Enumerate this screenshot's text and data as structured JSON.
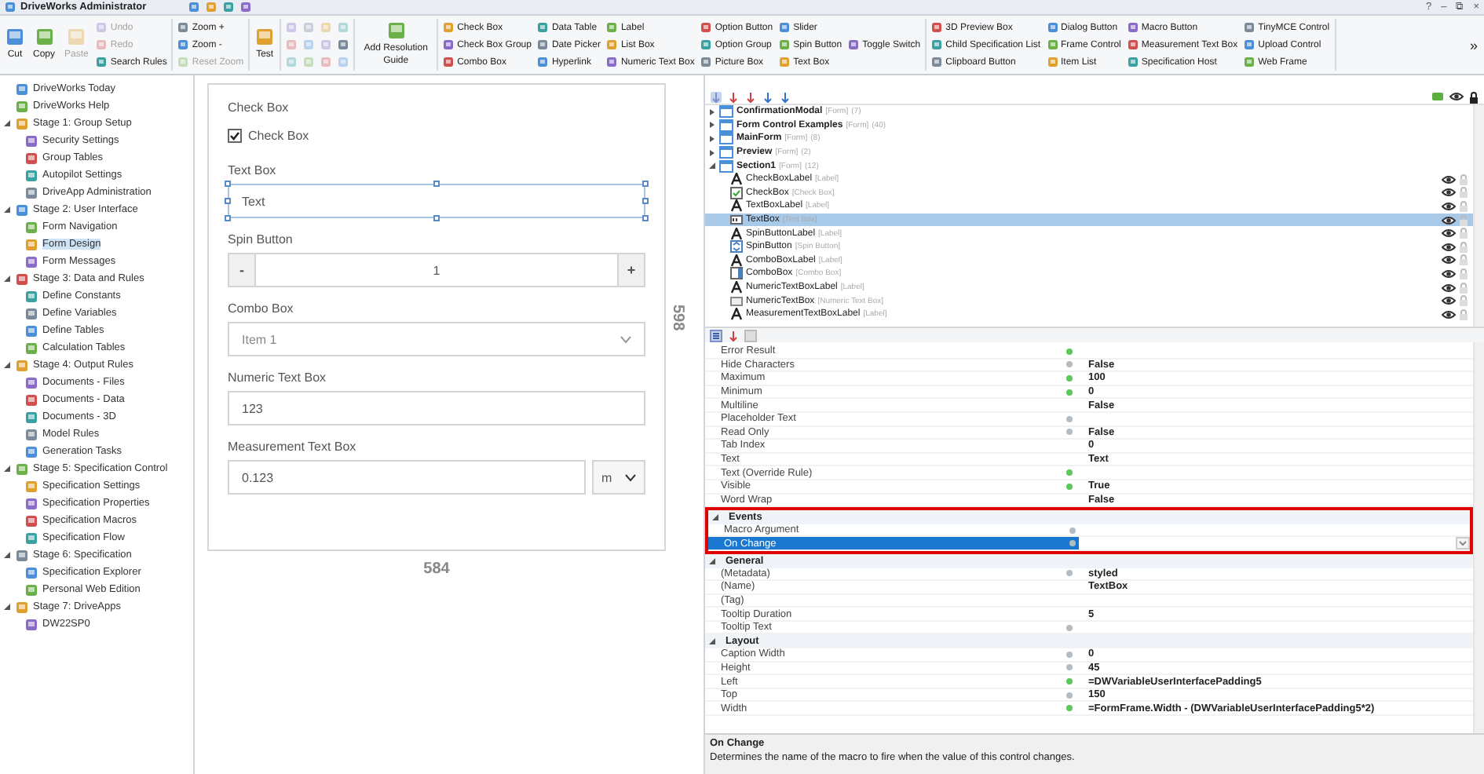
{
  "window": {
    "title": "DriveWorks Administrator",
    "controls": [
      "?",
      "–",
      "⧉",
      "×"
    ]
  },
  "ribbon": {
    "groups": [
      {
        "columns": [
          {
            "kind": "large",
            "label": "Cut",
            "disabled": false
          },
          {
            "kind": "large",
            "label": "Copy",
            "disabled": false
          },
          {
            "kind": "large",
            "label": "Paste",
            "disabled": true
          },
          {
            "kind": "stack",
            "items": [
              {
                "label": "Undo",
                "disabled": true
              },
              {
                "label": "Redo",
                "disabled": true
              },
              {
                "label": "Search Rules",
                "disabled": false
              }
            ]
          }
        ]
      },
      {
        "columns": [
          {
            "kind": "stack",
            "items": [
              {
                "label": "Zoom +",
                "disabled": false
              },
              {
                "label": "Zoom -",
                "disabled": false
              },
              {
                "label": "Reset Zoom",
                "disabled": true
              }
            ]
          }
        ]
      },
      {
        "columns": [
          {
            "kind": "large",
            "label": "Test",
            "disabled": false
          }
        ]
      },
      {
        "columns": [
          {
            "kind": "stack",
            "items": [
              {
                "disabled": true
              },
              {
                "disabled": true
              },
              {
                "disabled": true
              }
            ]
          },
          {
            "kind": "stack",
            "items": [
              {
                "disabled": true
              },
              {
                "disabled": true
              },
              {
                "disabled": true
              }
            ]
          },
          {
            "kind": "stack",
            "items": [
              {
                "disabled": true
              },
              {
                "disabled": true
              },
              {
                "disabled": true
              }
            ]
          },
          {
            "kind": "stack",
            "items": [
              {
                "disabled": true
              },
              {
                "disabled": false
              },
              {
                "disabled": true
              }
            ]
          }
        ]
      },
      {
        "columns": [
          {
            "kind": "large",
            "label": "Add Resolution Guide",
            "disabled": false
          }
        ]
      },
      {
        "columns": [
          {
            "kind": "stack",
            "items": [
              {
                "label": "Check Box",
                "disabled": false
              },
              {
                "label": "Check Box Group",
                "disabled": false
              },
              {
                "label": "Combo Box",
                "disabled": false
              }
            ]
          },
          {
            "kind": "stack",
            "items": [
              {
                "label": "Data Table",
                "disabled": false
              },
              {
                "label": "Date Picker",
                "disabled": false
              },
              {
                "label": "Hyperlink",
                "disabled": false
              }
            ]
          },
          {
            "kind": "stack",
            "items": [
              {
                "label": "Label",
                "disabled": false
              },
              {
                "label": "List Box",
                "disabled": false
              },
              {
                "label": "Numeric Text Box",
                "disabled": false
              }
            ]
          },
          {
            "kind": "stack",
            "items": [
              {
                "label": "Option Button",
                "disabled": false
              },
              {
                "label": "Option Group",
                "disabled": false
              },
              {
                "label": "Picture Box",
                "disabled": false
              }
            ]
          },
          {
            "kind": "stack",
            "items": [
              {
                "label": "Slider",
                "disabled": false
              },
              {
                "label": "Spin Button",
                "disabled": false
              },
              {
                "label": "Text Box",
                "disabled": false
              }
            ]
          },
          {
            "kind": "stack",
            "items": [
              {
                "label": "Toggle Switch",
                "disabled": false
              }
            ]
          }
        ]
      },
      {
        "columns": [
          {
            "kind": "stack",
            "items": [
              {
                "label": "3D Preview Box",
                "disabled": false
              },
              {
                "label": "Child Specification List",
                "disabled": false
              },
              {
                "label": "Clipboard Button",
                "disabled": false
              }
            ]
          },
          {
            "kind": "stack",
            "items": [
              {
                "label": "Dialog Button",
                "disabled": false
              },
              {
                "label": "Frame Control",
                "disabled": false
              },
              {
                "label": "Item List",
                "disabled": false
              }
            ]
          },
          {
            "kind": "stack",
            "items": [
              {
                "label": "Macro Button",
                "disabled": false
              },
              {
                "label": "Measurement Text Box",
                "disabled": false
              },
              {
                "label": "Specification Host",
                "disabled": false
              }
            ]
          },
          {
            "kind": "stack",
            "items": [
              {
                "label": "TinyMCE Control",
                "disabled": false
              },
              {
                "label": "Upload Control",
                "disabled": false
              },
              {
                "label": "Web Frame",
                "disabled": false
              }
            ]
          }
        ]
      }
    ],
    "overflow": "»"
  },
  "sidebar": {
    "items": [
      {
        "label": "DriveWorks Today",
        "selected": false
      },
      {
        "label": "DriveWorks Help",
        "selected": false
      },
      {
        "label": "Stage 1: Group Setup",
        "selected": false,
        "expanded": true,
        "children": [
          {
            "label": "Security Settings",
            "selected": false
          },
          {
            "label": "Group Tables",
            "selected": false
          },
          {
            "label": "Autopilot Settings",
            "selected": false
          },
          {
            "label": "DriveApp Administration",
            "selected": false
          }
        ]
      },
      {
        "label": "Stage 2: User Interface",
        "selected": false,
        "expanded": true,
        "children": [
          {
            "label": "Form Navigation",
            "selected": false
          },
          {
            "label": "Form Design",
            "selected": true
          },
          {
            "label": "Form Messages",
            "selected": false
          }
        ]
      },
      {
        "label": "Stage 3: Data and Rules",
        "selected": false,
        "expanded": true,
        "children": [
          {
            "label": "Define Constants",
            "selected": false
          },
          {
            "label": "Define Variables",
            "selected": false
          },
          {
            "label": "Define Tables",
            "selected": false
          },
          {
            "label": "Calculation Tables",
            "selected": false
          }
        ]
      },
      {
        "label": "Stage 4: Output Rules",
        "selected": false,
        "expanded": true,
        "children": [
          {
            "label": "Documents - Files",
            "selected": false
          },
          {
            "label": "Documents - Data",
            "selected": false
          },
          {
            "label": "Documents - 3D",
            "selected": false
          },
          {
            "label": "Model Rules",
            "selected": false
          },
          {
            "label": "Generation Tasks",
            "selected": false
          }
        ]
      },
      {
        "label": "Stage 5: Specification Control",
        "selected": false,
        "expanded": true,
        "children": [
          {
            "label": "Specification Settings",
            "selected": false
          },
          {
            "label": "Specification Properties",
            "selected": false
          },
          {
            "label": "Specification Macros",
            "selected": false
          },
          {
            "label": "Specification Flow",
            "selected": false
          }
        ]
      },
      {
        "label": "Stage 6: Specification",
        "selected": false,
        "expanded": true,
        "children": [
          {
            "label": "Specification Explorer",
            "selected": false
          },
          {
            "label": "Personal Web Edition",
            "selected": false
          }
        ]
      },
      {
        "label": "Stage 7: DriveApps",
        "selected": false,
        "expanded": true,
        "children": [
          {
            "label": "DW22SP0",
            "selected": false
          }
        ]
      }
    ]
  },
  "canvas": {
    "width_label": "584",
    "height_label": "598",
    "controls": [
      {
        "kind": "label",
        "text": "Check Box"
      },
      {
        "kind": "checkbox",
        "text": "Check Box",
        "checked": true,
        "selected": false
      },
      {
        "kind": "label",
        "text": "Text Box"
      },
      {
        "kind": "textbox",
        "value": "Text",
        "selected": true
      },
      {
        "kind": "label",
        "text": "Spin Button"
      },
      {
        "kind": "spin",
        "minus": "-",
        "value": "1",
        "plus": "+",
        "selected": false
      },
      {
        "kind": "label",
        "text": "Combo Box"
      },
      {
        "kind": "combo",
        "value": "Item 1",
        "selected": false
      },
      {
        "kind": "label",
        "text": "Numeric Text Box"
      },
      {
        "kind": "textbox",
        "value": "123",
        "selected": false
      },
      {
        "kind": "label",
        "text": "Measurement Text Box"
      },
      {
        "kind": "measurement",
        "value": "0.123",
        "unit": "m",
        "selected": false
      }
    ]
  },
  "tree": {
    "items": [
      {
        "name": "ConfirmationModal",
        "type": "[Form]",
        "count": "(7)",
        "expanded": false,
        "selected": false
      },
      {
        "name": "Form Control Examples",
        "type": "[Form]",
        "count": "(40)",
        "expanded": false,
        "selected": false
      },
      {
        "name": "MainForm",
        "type": "[Form]",
        "count": "(8)",
        "expanded": false,
        "selected": false
      },
      {
        "name": "Preview",
        "type": "[Form]",
        "count": "(2)",
        "expanded": false,
        "selected": false
      },
      {
        "name": "Section1",
        "type": "[Form]",
        "count": "(12)",
        "expanded": true,
        "selected": false,
        "children": [
          {
            "kind": "label",
            "name": "CheckBoxLabel",
            "type": "[Label]",
            "selected": false
          },
          {
            "kind": "checkbox",
            "name": "CheckBox",
            "type": "[Check Box]",
            "selected": false
          },
          {
            "kind": "label",
            "name": "TextBoxLabel",
            "type": "[Label]",
            "selected": false
          },
          {
            "kind": "textbox",
            "name": "TextBox",
            "type": "[Text Box]",
            "selected": true
          },
          {
            "kind": "label",
            "name": "SpinButtonLabel",
            "type": "[Label]",
            "selected": false
          },
          {
            "kind": "spin",
            "name": "SpinButton",
            "type": "[Spin Button]",
            "selected": false
          },
          {
            "kind": "label",
            "name": "ComboBoxLabel",
            "type": "[Label]",
            "selected": false
          },
          {
            "kind": "combo",
            "name": "ComboBox",
            "type": "[Combo Box]",
            "selected": false
          },
          {
            "kind": "label",
            "name": "NumericTextBoxLabel",
            "type": "[Label]",
            "selected": false
          },
          {
            "kind": "numeric",
            "name": "NumericTextBox",
            "type": "[Numeric Text Box]",
            "selected": false
          },
          {
            "kind": "label",
            "name": "MeasurementTextBoxLabel",
            "type": "[Label]",
            "selected": false
          }
        ]
      }
    ]
  },
  "properties": {
    "rows": [
      {
        "kind": "row",
        "name": "Error Result",
        "color": "#5cc85c",
        "selected": false
      },
      {
        "kind": "row",
        "name": "Hide Characters",
        "color": "#b4bcc4",
        "value": "False",
        "selected": false
      },
      {
        "kind": "row",
        "name": "Maximum",
        "color": "#5cc85c",
        "value": "100",
        "selected": false
      },
      {
        "kind": "row",
        "name": "Minimum",
        "color": "#5cc85c",
        "value": "0",
        "selected": false
      },
      {
        "kind": "row",
        "name": "Multiline",
        "value": "False",
        "selected": false
      },
      {
        "kind": "row",
        "name": "Placeholder Text",
        "color": "#b4bcc4",
        "selected": false
      },
      {
        "kind": "row",
        "name": "Read Only",
        "color": "#b4bcc4",
        "value": "False",
        "selected": false
      },
      {
        "kind": "row",
        "name": "Tab Index",
        "value": "0",
        "selected": false
      },
      {
        "kind": "row",
        "name": "Text",
        "value": "Text",
        "selected": false
      },
      {
        "kind": "row",
        "name": "Text (Override Rule)",
        "color": "#5cc85c",
        "selected": false
      },
      {
        "kind": "row",
        "name": "Visible",
        "color": "#5cc85c",
        "value": "True",
        "selected": false
      },
      {
        "kind": "row",
        "name": "Word Wrap",
        "value": "False",
        "selected": false
      },
      {
        "kind": "category",
        "name": "Events",
        "expanded": true,
        "highlighted": true
      },
      {
        "kind": "row",
        "name": "Macro Argument",
        "color": "#b4bcc4",
        "selected": false,
        "highlighted": true
      },
      {
        "kind": "row",
        "name": "On Change",
        "color": "#b4bcc4",
        "selected": true,
        "dropdown": true,
        "highlighted": true
      },
      {
        "kind": "category",
        "name": "General",
        "expanded": true
      },
      {
        "kind": "row",
        "name": "(Metadata)",
        "color": "#b4bcc4",
        "value": "styled",
        "selected": false
      },
      {
        "kind": "row",
        "name": "(Name)",
        "value": "TextBox",
        "selected": false
      },
      {
        "kind": "row",
        "name": "(Tag)",
        "selected": false
      },
      {
        "kind": "row",
        "name": "Tooltip Duration",
        "value": "5",
        "selected": false
      },
      {
        "kind": "row",
        "name": "Tooltip Text",
        "color": "#b4bcc4",
        "selected": false
      },
      {
        "kind": "category",
        "name": "Layout",
        "expanded": true
      },
      {
        "kind": "row",
        "name": "Caption Width",
        "color": "#b4bcc4",
        "value": "0",
        "selected": false
      },
      {
        "kind": "row",
        "name": "Height",
        "color": "#b4bcc4",
        "value": "45",
        "selected": false
      },
      {
        "kind": "row",
        "name": "Left",
        "color": "#5cc85c",
        "value": "=DWVariableUserInterfacePadding5",
        "selected": false
      },
      {
        "kind": "row",
        "name": "Top",
        "color": "#b4bcc4",
        "value": "150",
        "selected": false
      },
      {
        "kind": "row",
        "name": "Width",
        "color": "#5cc85c",
        "value": "=FormFrame.Width - (DWVariableUserInterfacePadding5*2)",
        "selected": false
      }
    ],
    "description": {
      "title": "On Change",
      "text": "Determines the name of the macro to fire when the value of this control changes."
    }
  }
}
